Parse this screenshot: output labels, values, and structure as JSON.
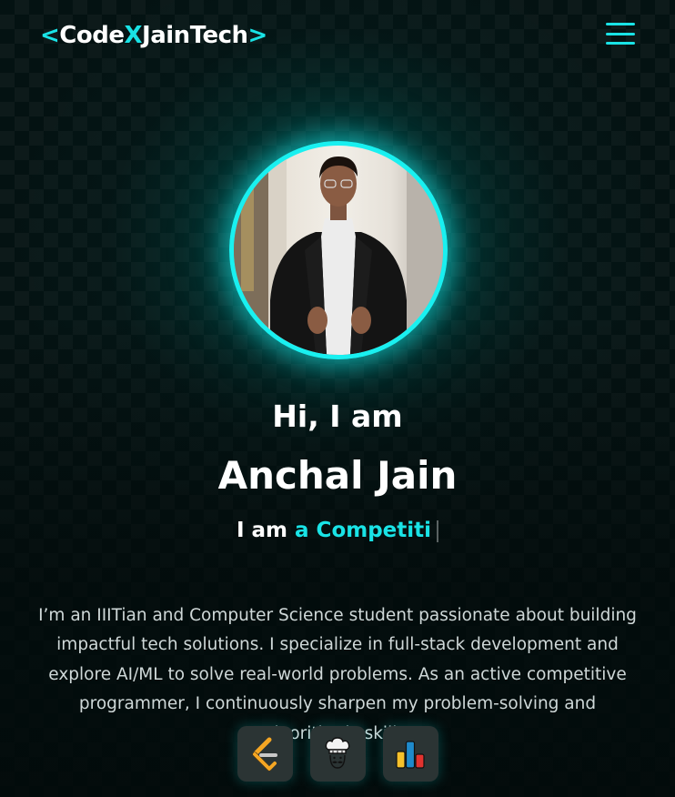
{
  "header": {
    "logo": {
      "open_bracket": "<",
      "part1": "Code",
      "part2": "X",
      "part3": "JainTech",
      "close_bracket": ">"
    },
    "menu_icon": "hamburger-icon"
  },
  "hero": {
    "avatar_alt": "Anchal Jain",
    "greeting": "Hi, I am",
    "name": "Anchal Jain",
    "role_prefix": "I am",
    "role_typed": "a Competiti",
    "bio": "I’m an IIITian and Computer Science student passionate about building impactful tech solutions. I specialize in full-stack development and explore AI/ML to solve real-world problems. As an active competitive programmer, I continuously sharpen my problem-solving and algorithmic skills."
  },
  "profiles": [
    {
      "icon": "leetcode-icon"
    },
    {
      "icon": "codechef-icon"
    },
    {
      "icon": "codeforces-icon"
    }
  ],
  "colors": {
    "accent": "#19e3e6",
    "background": "#030f0f",
    "text": "#ffffff",
    "muted_text": "#cfd8d8"
  }
}
